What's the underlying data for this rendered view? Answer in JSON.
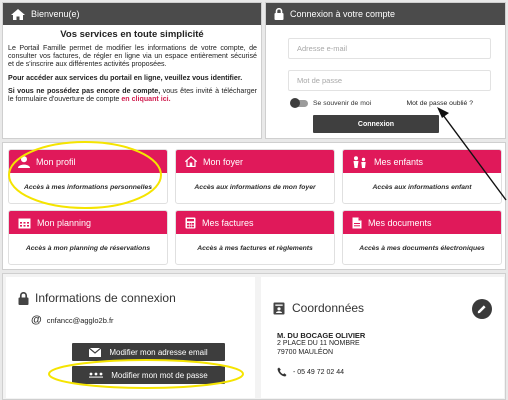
{
  "welcome": {
    "header": "Bienvenu(e)",
    "title": "Vos services en toute simplicité",
    "p1": "Le Portail Famille permet de modifier les informations de votre compte, de consulter vos factures, de régler en ligne via un espace entièrement sécurisé et de s'inscrire aux différentes activités proposées.",
    "p2": "Pour accéder aux services du portail en ligne, veuillez vous identifier.",
    "p3_bold": "Si vous ne possédez pas encore de compte,",
    "p3_text": " vous êtes invité à télécharger le formulaire d'ouverture de compte ",
    "p3_link": "en cliquant ici."
  },
  "login": {
    "header": "Connexion à votre compte",
    "email_placeholder": "Adresse e-mail",
    "password_placeholder": "Mot de passe",
    "remember_label": "Se souvenir de moi",
    "forgot_label": "Mot de passe oublié ?",
    "submit_label": "Connexion"
  },
  "tiles": [
    {
      "label": "Mon profil",
      "desc": "Accès à mes informations personnelles",
      "icon": "user-icon"
    },
    {
      "label": "Mon foyer",
      "desc": "Accès aux informations de mon foyer",
      "icon": "home-icon"
    },
    {
      "label": "Mes enfants",
      "desc": "Accès aux informations enfant",
      "icon": "children-icon"
    },
    {
      "label": "Mon planning",
      "desc": "Accès à mon planning de réservations",
      "icon": "calendar-icon"
    },
    {
      "label": "Mes factures",
      "desc": "Accès à mes factures et règlements",
      "icon": "calculator-icon"
    },
    {
      "label": "Mes documents",
      "desc": "Accès à mes documents électroniques",
      "icon": "document-icon"
    }
  ],
  "connexion": {
    "title": "Informations de connexion",
    "email": "cnfancc@agglo2b.fr",
    "change_email_label": "Modifier mon adresse email",
    "change_password_label": "Modifier mon mot de passe"
  },
  "coordonnees": {
    "title": "Coordonnées",
    "name": "M. DU BOCAGE OLIVIER",
    "address_line1": "2 PLACE DU 11 NOMBRE",
    "address_line2": "79700 MAULÉON",
    "phone": "- 05 49 72 02 44"
  },
  "colors": {
    "accent": "#e0195a",
    "header_dark": "#4b4b4b",
    "highlight": "#f5e400"
  }
}
